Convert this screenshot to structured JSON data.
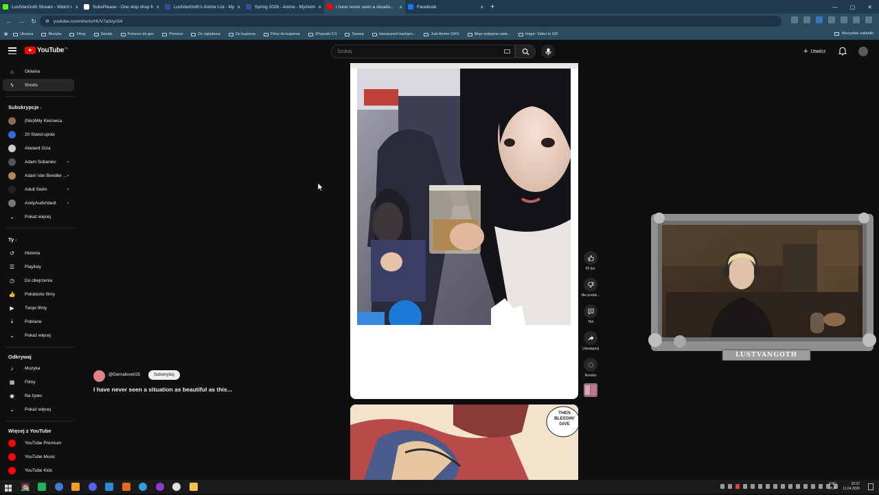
{
  "browser": {
    "tabs": [
      {
        "title": "LustVanGoth Stream - Watch Li...",
        "color": "#53fc18"
      },
      {
        "title": "SubsPlease - One stop shop fo...",
        "color": "#ffffff"
      },
      {
        "title": "LustVanGoth's Anime List - My...",
        "color": "#2e51a2"
      },
      {
        "title": "Spring 2026 - Anime - MyAnim...",
        "color": "#2e51a2"
      },
      {
        "title": "I have never seen a situatio...",
        "color": "#ff0000"
      },
      {
        "title": "Facebook",
        "color": "#1877f2"
      }
    ],
    "url": "youtube.com/shorts/HUV7a3oyc54",
    "bookmarks": [
      "Ubrania",
      "Muzyka",
      "Filmy",
      "Seriale",
      "Pomoce do gier",
      "Pomoce",
      "Do oglądania",
      "Do kupienia",
      "Filmy do kupienia",
      "JPopuski 2.0",
      "Трекер",
      "transparent backgro...",
      "Just Anime GIFS",
      "Moje wstępnie zatw...",
      "Imgur: Video to GIF"
    ],
    "bookmarks_right": "Wszystkie zakładki"
  },
  "header": {
    "logo": "YouTube",
    "country": "PL",
    "search_placeholder": "Szukaj",
    "create_label": "Utwórz"
  },
  "sidebar": {
    "main": [
      {
        "label": "Główna",
        "icon": "home-icon"
      },
      {
        "label": "Shorts",
        "icon": "shorts-icon",
        "selected": true
      }
    ],
    "subs_heading": "Subskrypcje",
    "subs": [
      {
        "label": "(Nie)Miły Kierowca",
        "color": "#8b6b4a",
        "dot": false
      },
      {
        "label": "20 Stand-upów",
        "color": "#2d6cdf",
        "dot": false
      },
      {
        "label": "Abelard Giza",
        "color": "#cccccc",
        "dot": false
      },
      {
        "label": "Adam Sobaniec",
        "color": "#555555",
        "dot": true
      },
      {
        "label": "Adam Van Bendler ...",
        "color": "#b08858",
        "dot": true
      },
      {
        "label": "Adult Swim",
        "color": "#222222",
        "dot": true
      },
      {
        "label": "AndyAudioVault",
        "color": "#777777",
        "dot": true
      }
    ],
    "show_more": "Pokaż więcej",
    "you_heading": "Ty",
    "you": [
      {
        "label": "Historia",
        "icon": "history-icon"
      },
      {
        "label": "Playlisty",
        "icon": "playlist-icon"
      },
      {
        "label": "Do obejrzenia",
        "icon": "watch-later-icon"
      },
      {
        "label": "Polubione filmy",
        "icon": "like-icon"
      },
      {
        "label": "Twoje filmy",
        "icon": "your-videos-icon"
      },
      {
        "label": "Pobrane",
        "icon": "download-icon"
      }
    ],
    "explore_heading": "Odkrywaj",
    "explore": [
      {
        "label": "Muzyka",
        "icon": "music-icon"
      },
      {
        "label": "Filmy",
        "icon": "film-icon"
      },
      {
        "label": "Na żywo",
        "icon": "live-icon"
      }
    ],
    "more_heading": "Więcej z YouTube",
    "more": [
      {
        "label": "YouTube Premium",
        "color": "#ff0000"
      },
      {
        "label": "YouTube Music",
        "color": "#ff0000"
      },
      {
        "label": "YouTube Kids",
        "color": "#ff0000"
      }
    ]
  },
  "short": {
    "channel": "@Eternallove025",
    "subscribe": "Subskrybuj",
    "title": "I have never seen a situation as beautiful as this...",
    "actions": {
      "likes": "55 tys.",
      "dislike": "Nie podob...",
      "comments": "764",
      "share": "Udostępnij",
      "remix": "Remiks"
    },
    "next_caption": [
      "THEN",
      "BLEEDIN'",
      "GIVE"
    ]
  },
  "webcam": {
    "label": "LUSTVANGOTH"
  },
  "taskbar": {
    "lang_top": "ENG",
    "lang_bottom": "PLP",
    "time": "22:37",
    "date": "11.04.2026"
  }
}
